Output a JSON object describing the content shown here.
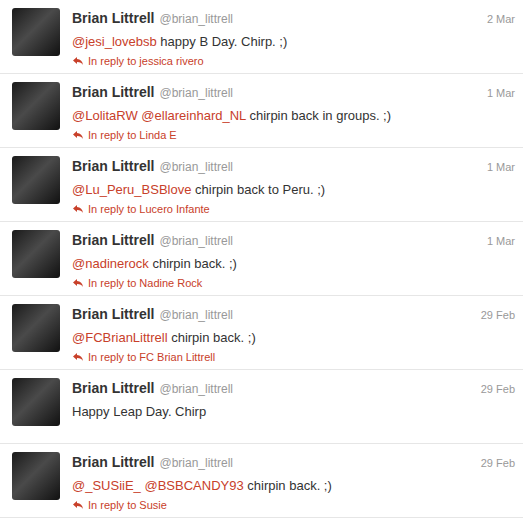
{
  "timeline": {
    "tweets": [
      {
        "name": "Brian Littrell",
        "handle": "@brian_littrell",
        "date": "2 Mar",
        "segments": [
          {
            "text": "@jesi_lovebsb",
            "kind": "mention"
          },
          {
            "text": " happy B Day. Chirp. ;)",
            "kind": "text"
          }
        ],
        "reply": "In reply to jessica rivero"
      },
      {
        "name": "Brian Littrell",
        "handle": "@brian_littrell",
        "date": "1 Mar",
        "segments": [
          {
            "text": "@LolitaRW",
            "kind": "mention"
          },
          {
            "text": " ",
            "kind": "text"
          },
          {
            "text": "@ellareinhard_NL",
            "kind": "mention"
          },
          {
            "text": " chirpin back in groups. ;)",
            "kind": "text"
          }
        ],
        "reply": "In reply to Linda E"
      },
      {
        "name": "Brian Littrell",
        "handle": "@brian_littrell",
        "date": "1 Mar",
        "segments": [
          {
            "text": "@Lu_Peru_BSBlove",
            "kind": "mention"
          },
          {
            "text": " chirpin back to Peru. ;)",
            "kind": "text"
          }
        ],
        "reply": "In reply to Lucero Infante"
      },
      {
        "name": "Brian Littrell",
        "handle": "@brian_littrell",
        "date": "1 Mar",
        "segments": [
          {
            "text": "@nadinerock",
            "kind": "mention"
          },
          {
            "text": " chirpin back. ;)",
            "kind": "text"
          }
        ],
        "reply": "In reply to Nadine Rock"
      },
      {
        "name": "Brian Littrell",
        "handle": "@brian_littrell",
        "date": "29 Feb",
        "segments": [
          {
            "text": "@FCBrianLittrell",
            "kind": "mention"
          },
          {
            "text": " chirpin back. ;)",
            "kind": "text"
          }
        ],
        "reply": "In reply to FC Brian Littrell"
      },
      {
        "name": "Brian Littrell",
        "handle": "@brian_littrell",
        "date": "29 Feb",
        "segments": [
          {
            "text": "Happy Leap Day. Chirp",
            "kind": "text"
          }
        ]
      },
      {
        "name": "Brian Littrell",
        "handle": "@brian_littrell",
        "date": "29 Feb",
        "segments": [
          {
            "text": "@_SUSiiE_",
            "kind": "mention"
          },
          {
            "text": " ",
            "kind": "text"
          },
          {
            "text": "@BSBCANDY93",
            "kind": "mention"
          },
          {
            "text": " chirpin back. ;)",
            "kind": "text"
          }
        ],
        "reply": "In reply to Susie"
      }
    ]
  }
}
